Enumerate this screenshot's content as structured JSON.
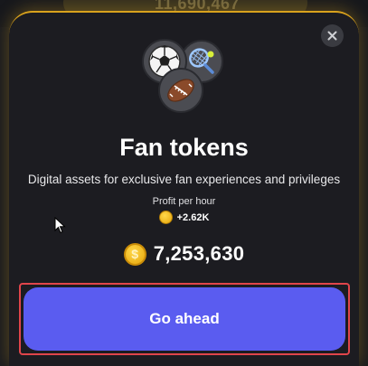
{
  "background": {
    "balance_text": "11,690,467"
  },
  "modal": {
    "close_icon": "close-icon",
    "icons": [
      "soccer-ball-icon",
      "tennis-racket-icon",
      "american-football-icon"
    ],
    "title": "Fan tokens",
    "description": "Digital assets for exclusive fan experiences and privileges",
    "profit_label": "Profit per hour",
    "profit_value": "+2.62K",
    "balance": "7,253,630",
    "coin_symbol": "$",
    "cta_label": "Go ahead"
  },
  "colors": {
    "accent_gold": "#d9a21c",
    "cta_purple": "#5a5cf0",
    "highlight_red": "#e0454b",
    "panel": "#1c1c21"
  }
}
